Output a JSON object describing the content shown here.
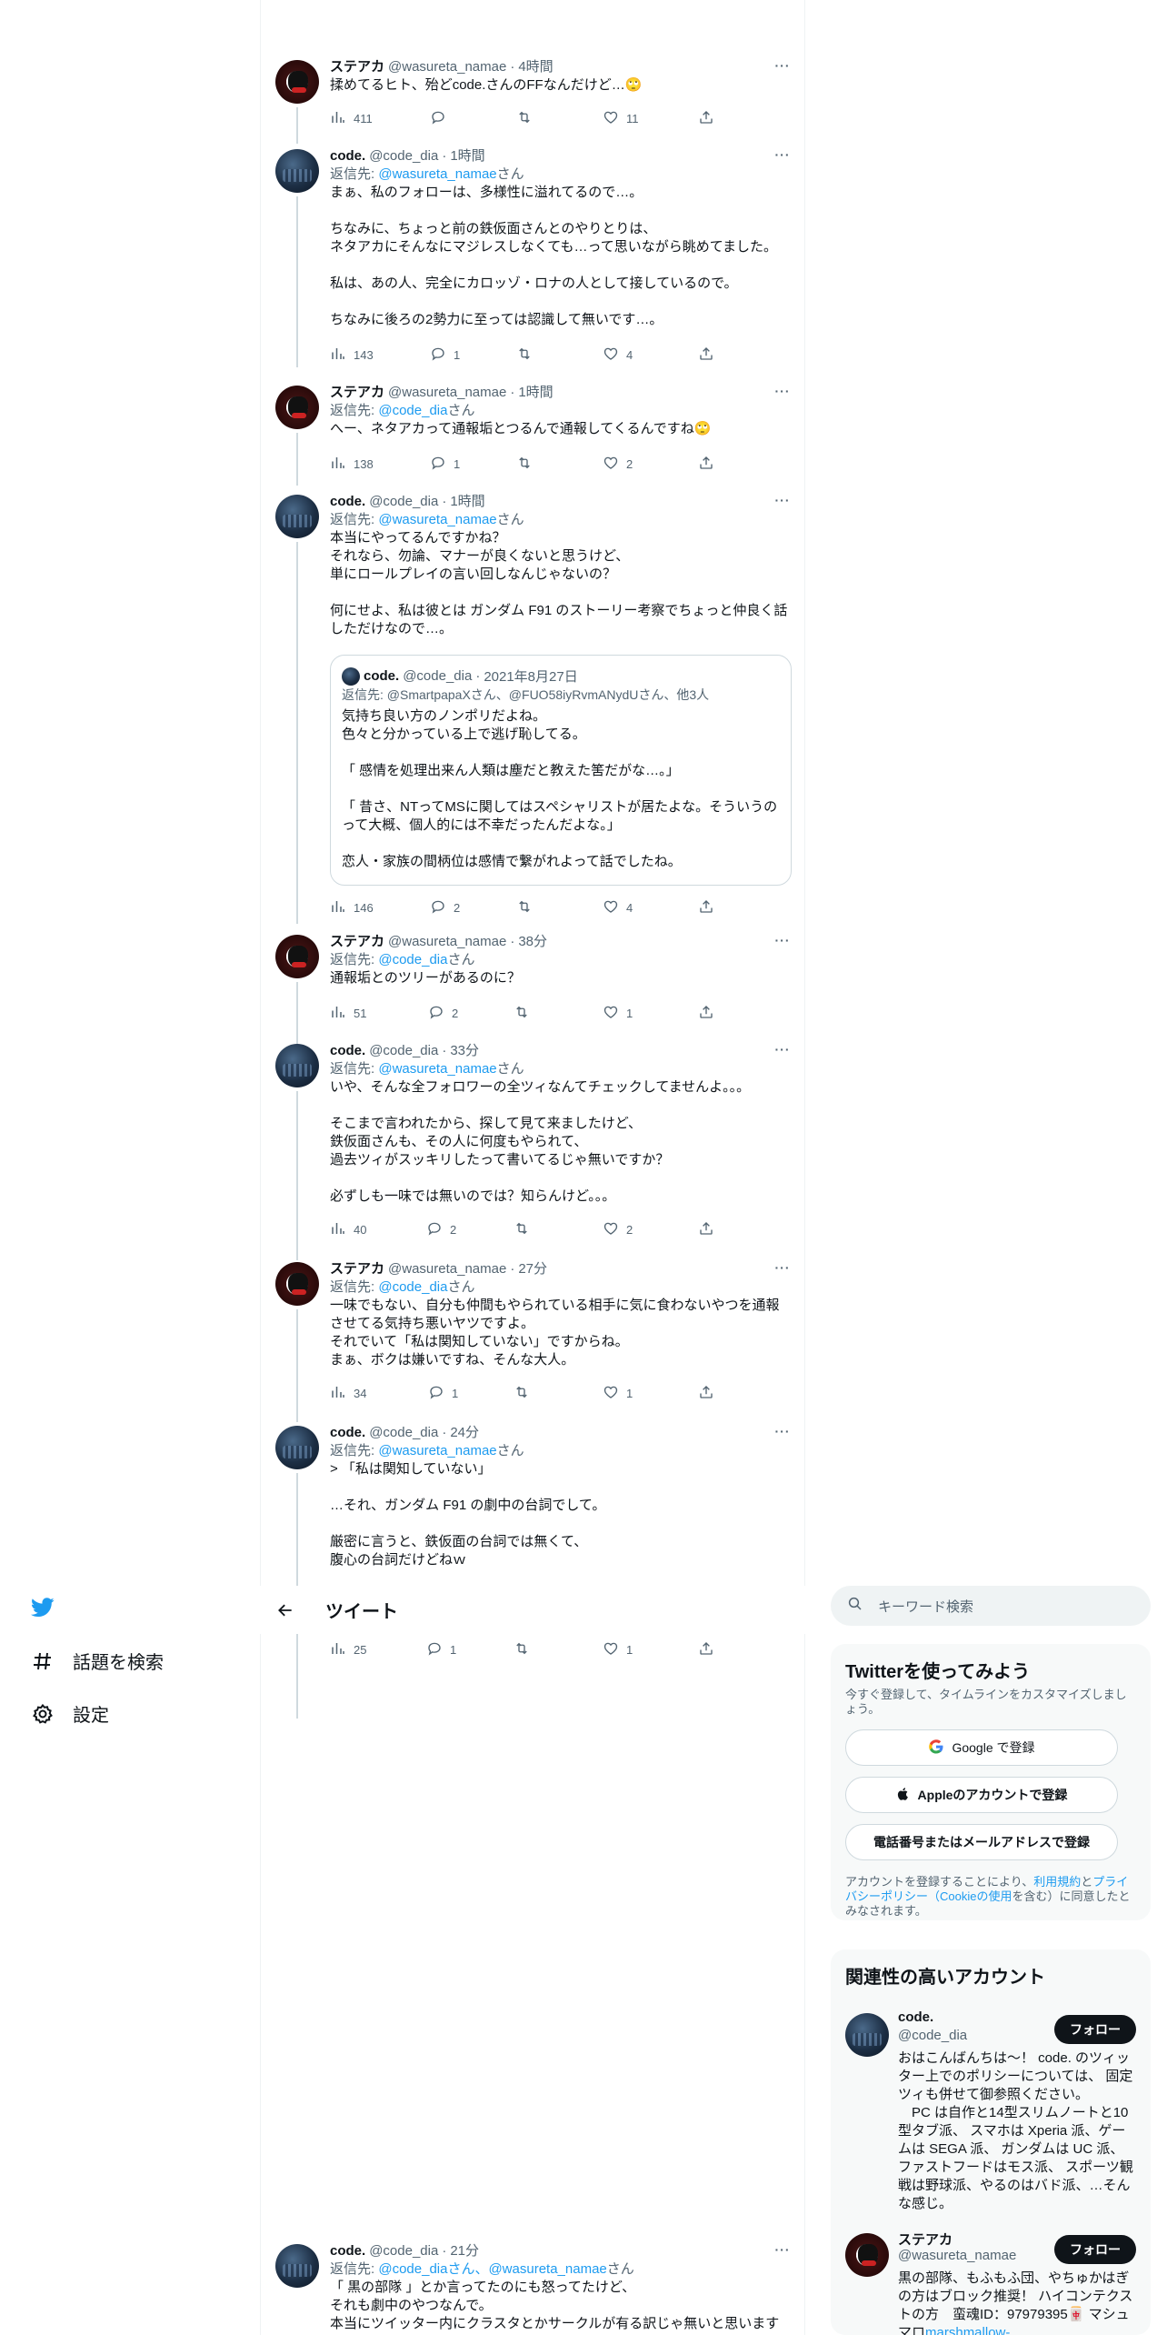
{
  "nav": {
    "search_label": "話題を検索",
    "settings_label": "設定"
  },
  "header": {
    "title": "ツイート"
  },
  "search": {
    "placeholder": "キーワード検索"
  },
  "tweets": [
    {
      "name": "ステアカ",
      "handle": "@wasureta_namae",
      "time": "4時間",
      "reply_to": null,
      "text": "揉めてるヒト、殆どcode.さんのFFなんだけど…🙄",
      "views": "411",
      "replies": "",
      "retweets": "",
      "likes": "11"
    },
    {
      "name": "code.",
      "handle": "@code_dia",
      "time": "1時間",
      "reply_prefix": "返信先: ",
      "reply_to": "@wasureta_namae",
      "reply_suffix": "さん",
      "text": "まぁ、私のフォローは、多様性に溢れてるので…。\n\nちなみに、ちょっと前の鉄仮面さんとのやりとりは、\nネタアカにそんなにマジレスしなくても…って思いながら眺めてました。\n\n私は、あの人、完全にカロッゾ・ロナの人として接しているので。\n\nちなみに後ろの2勢力に至っては認識して無いです…。",
      "views": "143",
      "replies": "1",
      "retweets": "",
      "likes": "4"
    },
    {
      "name": "ステアカ",
      "handle": "@wasureta_namae",
      "time": "1時間",
      "reply_prefix": "返信先: ",
      "reply_to": "@code_dia",
      "reply_suffix": "さん",
      "text": "へー、ネタアカって通報垢とつるんで通報してくるんですね🙄",
      "views": "138",
      "replies": "1",
      "retweets": "",
      "likes": "2"
    },
    {
      "name": "code.",
      "handle": "@code_dia",
      "time": "1時間",
      "reply_prefix": "返信先: ",
      "reply_to": "@wasureta_namae",
      "reply_suffix": "さん",
      "text": "本当にやってるんですかね？\nそれなら、勿論、マナーが良くないと思うけど、\n単にロールプレイの言い回しなんじゃないの？\n\n何にせよ、私は彼とは ガンダム F91 のストーリー考察でちょっと仲良く話しただけなので…。",
      "views": "146",
      "replies": "2",
      "retweets": "",
      "likes": "4",
      "quote": {
        "name": "code.",
        "handle": "@code_dia",
        "time": "2021年8月27日",
        "reply_line": "返信先: @SmartpapaXさん、@FUO58iyRvmANydUさん、他3人",
        "text": "気持ち良い方のノンポリだよね。\n色々と分かっている上で逃げ恥してる。\n\n「 感情を処理出来ん人類は塵だと教えた筈だがな…。」\n\n「 昔さ、NTってMSに関してはスペシャリストが居たよな。そういうのって大概、個人的には不幸だったんだよな。」\n\n恋人・家族の間柄位は感情で繋がれよって話でしたね。"
      }
    },
    {
      "name": "ステアカ",
      "handle": "@wasureta_namae",
      "time": "38分",
      "reply_prefix": "返信先: ",
      "reply_to": "@code_dia",
      "reply_suffix": "さん",
      "text": "通報垢とのツリーがあるのに？",
      "views": "51",
      "replies": "2",
      "retweets": "",
      "likes": "1"
    },
    {
      "name": "code.",
      "handle": "@code_dia",
      "time": "33分",
      "reply_prefix": "返信先: ",
      "reply_to": "@wasureta_namae",
      "reply_suffix": "さん",
      "text": "いや、そんな全フォロワーの全ツィなんてチェックしてませんよ。。。\n\nそこまで言われたから、探して見て来ましたけど、\n鉄仮面さんも、その人に何度もやられて、\n過去ツィがスッキリしたって書いてるじゃ無いですか？\n\n必ずしも一味では無いのでは？知らんけど。。。",
      "views": "40",
      "replies": "2",
      "retweets": "",
      "likes": "2"
    },
    {
      "name": "ステアカ",
      "handle": "@wasureta_namae",
      "time": "27分",
      "reply_prefix": "返信先: ",
      "reply_to": "@code_dia",
      "reply_suffix": "さん",
      "text": "一味でもない、自分も仲間もやられている相手に気に食わないやつを通報させてる気持ち悪いヤツですよ。\nそれでいて「私は関知していない」ですからね。\nまぁ、ボクは嫌いですね、そんな大人。",
      "views": "34",
      "replies": "1",
      "retweets": "",
      "likes": "1"
    },
    {
      "name": "code.",
      "handle": "@code_dia",
      "time": "24分",
      "reply_prefix": "返信先: ",
      "reply_to": "@wasureta_namae",
      "reply_suffix": "さん",
      "text": "> 「私は関知していない」\n\n…それ、ガンダム F91 の劇中の台詞でして。\n\n厳密に言うと、鉄仮面の台詞では無くて、\n腹心の台詞だけどねｗ",
      "views": "25",
      "replies": "1",
      "retweets": "",
      "likes": "1"
    },
    {
      "name": "code.",
      "handle": "@code_dia",
      "time": "21分",
      "reply_prefix": "返信先: ",
      "reply_to": "@code_diaさん、@wasureta_namae",
      "reply_suffix": "さん",
      "text": "「 黒の部隊 」とか言ってたのにも怒ってたけど、\nそれも劇中のやつなんで。\n本当にツイッター内にクラスタとかサークルが有る訳じゃ無いと思います"
    }
  ],
  "signup": {
    "title": "Twitterを使ってみよう",
    "subtitle": "今すぐ登録して、タイムラインをカスタマイズしましょう。",
    "google_btn": "Google で登録",
    "apple_btn": "Appleのアカウントで登録",
    "phone_btn": "電話番号またはメールアドレスで登録",
    "terms_pre": "アカウントを登録することにより、",
    "terms_link1": "利用規約",
    "terms_mid": "と",
    "terms_link2": "プライバシーポリシー（Cookieの使用",
    "terms_post": "を含む）に同意したとみなされます。"
  },
  "related": {
    "title": "関連性の高いアカウント",
    "follow_label": "フォロー",
    "accounts": [
      {
        "name": "code.",
        "handle": "@code_dia",
        "bio": "おはこんばんちは～！ code. のツィッター上でのポリシーについては、 固定ツィも併せて御参照ください。\n　PC は自作と14型スリムノートと10型タブ派、 スマホは Xperia 派、ゲームは SEGA 派、 ガンダムは UC 派、ファストフードはモス派、 スポーツ観戦は野球派、やるのはバド派、…そんな感じ。"
      },
      {
        "name": "ステアカ",
        "handle": "@wasureta_namae",
        "bio": "黒の部隊、もふもふ団、やちゅかはぎの方はブロック推奨！ ハイコンテクストの方　蛮魂ID：97979395🀄 マシュマロ",
        "bio_link": "marshmallow-"
      }
    ]
  },
  "colors": {
    "accent": "#1d9bf0",
    "text": "#0f1419",
    "muted": "#536471",
    "border": "#eff3f4",
    "panel": "#f7f9f9"
  }
}
